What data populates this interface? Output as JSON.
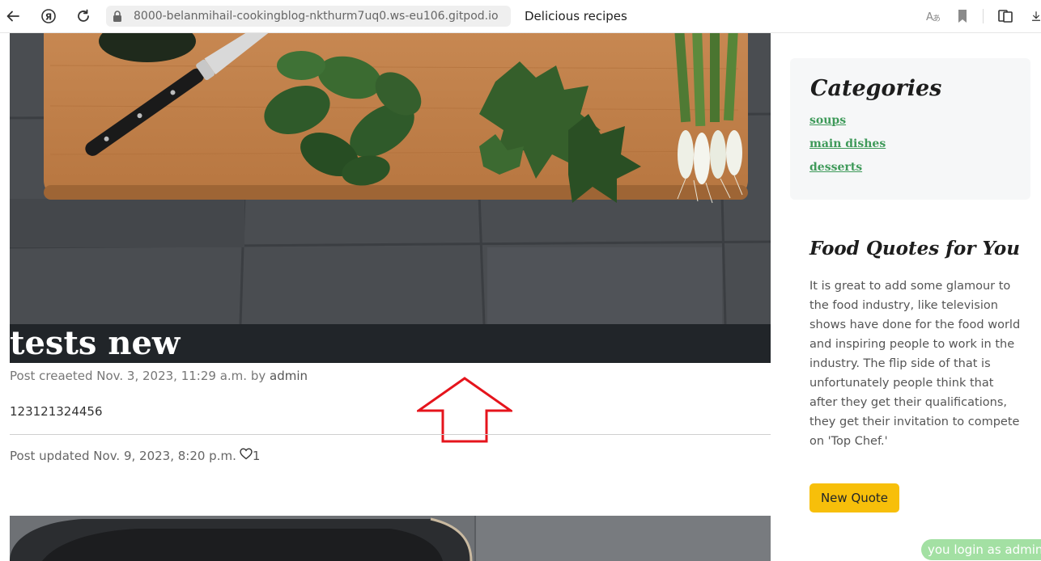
{
  "browser": {
    "url": "8000-belanmihail-cookingblog-nkthurm7uq0.ws-eu106.gitpod.io",
    "page_title": "Delicious recipes",
    "icons": [
      "back-icon",
      "yandex-icon",
      "reload-icon",
      "lock-icon",
      "translate-icon",
      "bookmark-icon",
      "collections-icon",
      "download-icon"
    ]
  },
  "post": {
    "title": "tests new",
    "created_label": "Post creaeted Nov. 3, 2023, 11:29 a.m. by",
    "author": "admin",
    "body": "123121324456",
    "updated_label": "Post updated Nov. 9, 2023, 8:20 p.m.",
    "likes": "1",
    "like_icon": "heart-outline-icon"
  },
  "sidebar": {
    "categories_title": "Categories",
    "categories": [
      "soups",
      "main dishes",
      "desserts"
    ],
    "quotes_title": "Food Quotes for You",
    "quote": "It is great to add some glamour to the food industry, like television shows have done for the food world and inspiring people to work in the industry. The flip side of that is unfortunately people think that after they get their qualifications, they get their invitation to compete on 'Top Chef.'",
    "new_quote_button": "New Quote"
  },
  "status": {
    "login_text": "you login as admin"
  },
  "colors": {
    "accent_green": "#3f9a5a",
    "button_yellow": "#f7bf0a",
    "title_band": "#212529",
    "arrow_red": "#e5141c",
    "login_badge": "#a3e0a3"
  }
}
